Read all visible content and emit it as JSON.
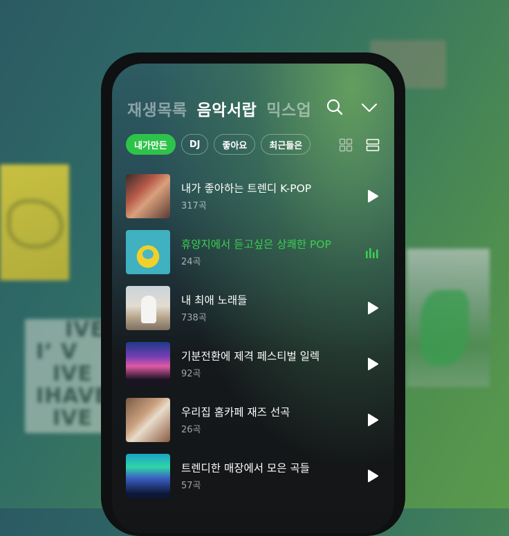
{
  "header": {
    "tabs": [
      {
        "label": "재생목록",
        "active": false
      },
      {
        "label": "음악서랍",
        "active": true
      },
      {
        "label": "믹스업",
        "active": false
      }
    ],
    "search_icon": "search-icon",
    "dropdown_icon": "chevron-down-icon"
  },
  "filters": {
    "chips": [
      {
        "label": "내가만든",
        "active": true
      },
      {
        "label": "DJ",
        "active": false
      },
      {
        "label": "좋아요",
        "active": false
      },
      {
        "label": "최근들은",
        "active": false
      }
    ],
    "grid_view_icon": "grid-view-icon",
    "list_view_icon": "list-view-icon"
  },
  "playlists": [
    {
      "title": "내가 좋아하는 트렌디 K-POP",
      "count": "317곡",
      "playing": false
    },
    {
      "title": "휴양지에서 듣고싶은 상쾌한 POP",
      "count": "24곡",
      "playing": true
    },
    {
      "title": "내 최애 노래들",
      "count": "738곡",
      "playing": false
    },
    {
      "title": "기분전환에 제격 페스티벌 일렉",
      "count": "92곡",
      "playing": false
    },
    {
      "title": "우리집 홈카페 재즈 선곡",
      "count": "26곡",
      "playing": false
    },
    {
      "title": "트렌디한 매장에서 모은 곡들",
      "count": "57곡",
      "playing": false
    }
  ],
  "background_text": {
    "ive_lines": [
      "IVE",
      "I’  V",
      "IVE",
      "IHAVE",
      "IVE"
    ]
  },
  "colors": {
    "accent": "#2fc24a",
    "playing_text": "#3ad04f"
  }
}
